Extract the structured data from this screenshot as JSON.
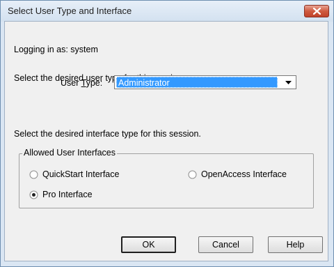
{
  "window": {
    "title": "Select User Type and Interface"
  },
  "login": {
    "text": "Logging in as: system"
  },
  "user_type": {
    "prompt": "Select the desired user type for this session.",
    "label_prefix": "User ",
    "label_access_key": "T",
    "label_suffix": "ype:",
    "selected": "Administrator"
  },
  "interface": {
    "prompt": "Select the desired interface type for this session.",
    "group_label": "Allowed User Interfaces",
    "options": [
      {
        "label": "QuickStart Interface",
        "selected": false
      },
      {
        "label": "OpenAccess Interface",
        "selected": false
      },
      {
        "label": "Pro Interface",
        "selected": true
      }
    ]
  },
  "buttons": {
    "ok": "OK",
    "cancel": "Cancel",
    "help": "Help"
  },
  "colors": {
    "selection_highlight": "#3399ff",
    "close_button": "#c7462c",
    "titlebar": "#dae6f3"
  }
}
